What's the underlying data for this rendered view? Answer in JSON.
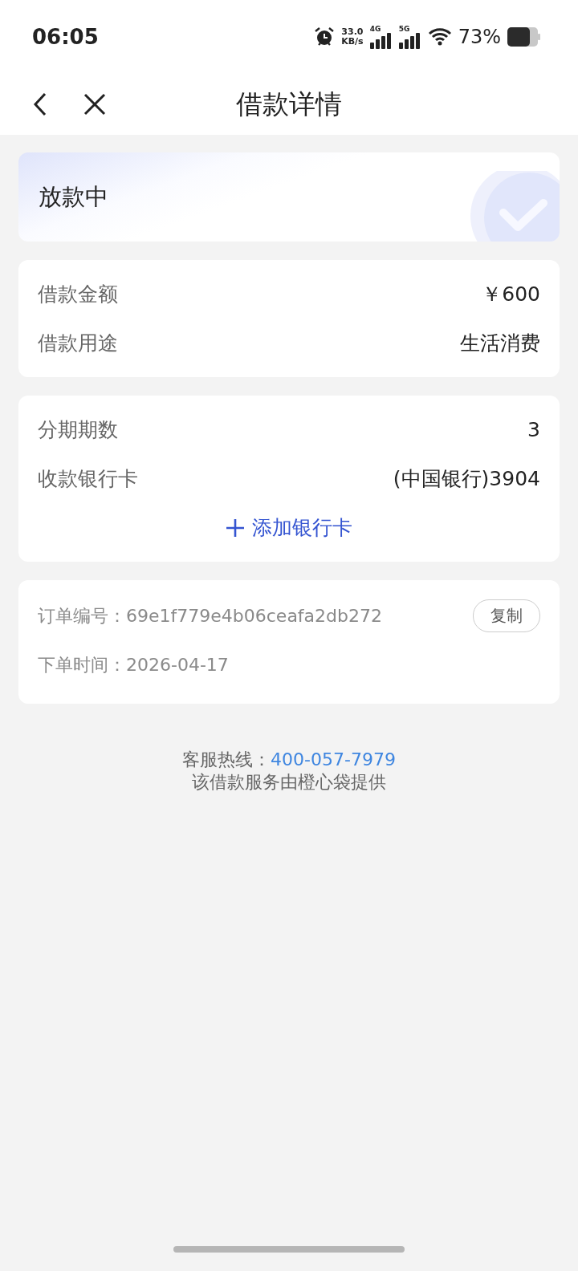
{
  "status_bar": {
    "time": "06:05",
    "net_speed": "33.0",
    "net_unit": "KB/s",
    "sim1": "4G",
    "sim2": "5G",
    "battery": "73%"
  },
  "nav": {
    "title": "借款详情"
  },
  "status_card": {
    "label": "放款中"
  },
  "loan_card": {
    "rows": [
      {
        "label": "借款金额",
        "value": "￥600"
      },
      {
        "label": "借款用途",
        "value": "生活消费"
      }
    ]
  },
  "installment_card": {
    "rows": [
      {
        "label": "分期期数",
        "value": "3"
      },
      {
        "label": "收款银行卡",
        "value": "(中国银行)3904"
      }
    ],
    "add_button": "添加银行卡"
  },
  "order_card": {
    "order_label": "订单编号：",
    "order_no": "69e1f779e4b06ceafa2db272",
    "copy_button": "复制",
    "time_label": "下单时间：",
    "time": "2026-04-17"
  },
  "footer": {
    "hotline_label": "客服热线：",
    "hotline": "400-057-7979",
    "provider": "该借款服务由橙心袋提供"
  }
}
